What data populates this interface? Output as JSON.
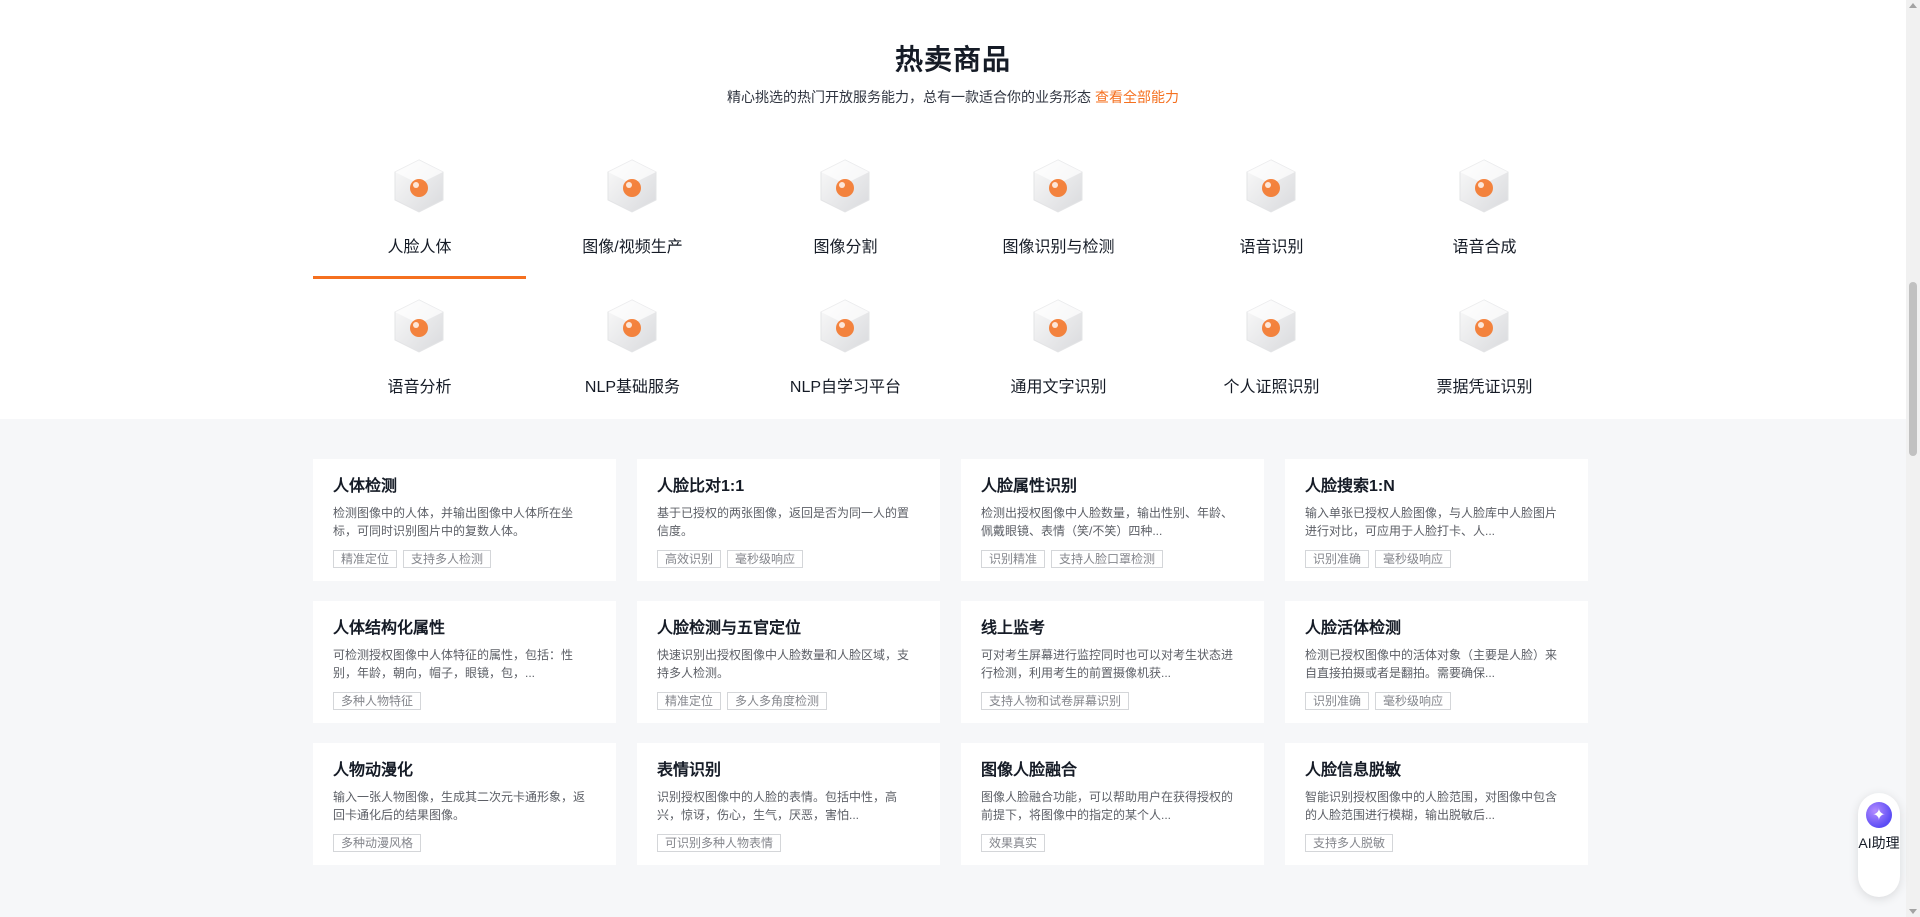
{
  "header": {
    "title": "热卖商品",
    "subtitle": "精心挑选的热门开放服务能力，总有一款适合你的业务形态",
    "link": "查看全部能力"
  },
  "categories": [
    {
      "label": "人脸人体",
      "icon": "face-body-icon",
      "active": true
    },
    {
      "label": "图像/视频生产",
      "icon": "image-video-icon"
    },
    {
      "label": "图像分割",
      "icon": "image-segment-icon"
    },
    {
      "label": "图像识别与检测",
      "icon": "image-recognition-icon"
    },
    {
      "label": "语音识别",
      "icon": "speech-recognition-icon"
    },
    {
      "label": "语音合成",
      "icon": "speech-synthesis-icon"
    },
    {
      "label": "语音分析",
      "icon": "speech-analysis-icon"
    },
    {
      "label": "NLP基础服务",
      "icon": "nlp-basic-icon"
    },
    {
      "label": "NLP自学习平台",
      "icon": "nlp-platform-icon"
    },
    {
      "label": "通用文字识别",
      "icon": "ocr-icon"
    },
    {
      "label": "个人证照识别",
      "icon": "id-card-icon"
    },
    {
      "label": "票据凭证识别",
      "icon": "receipt-icon"
    }
  ],
  "cards": [
    {
      "title": "人体检测",
      "desc": "检测图像中的人体，并输出图像中人体所在坐标，可同时识别图片中的复数人体。",
      "tags": [
        "精准定位",
        "支持多人检测"
      ]
    },
    {
      "title": "人脸比对1:1",
      "desc": "基于已授权的两张图像，返回是否为同一人的置信度。",
      "tags": [
        "高效识别",
        "毫秒级响应"
      ]
    },
    {
      "title": "人脸属性识别",
      "desc": "检测出授权图像中人脸数量，输出性别、年龄、佩戴眼镜、表情（笑/不笑）四种...",
      "tags": [
        "识别精准",
        "支持人脸口罩检测"
      ]
    },
    {
      "title": "人脸搜索1:N",
      "desc": "输入单张已授权人脸图像，与人脸库中人脸图片进行对比，可应用于人脸打卡、人...",
      "tags": [
        "识别准确",
        "毫秒级响应"
      ]
    },
    {
      "title": "人体结构化属性",
      "desc": "可检测授权图像中人体特征的属性，包括：性别，年龄，朝向，帽子，眼镜，包，...",
      "tags": [
        "多种人物特征"
      ]
    },
    {
      "title": "人脸检测与五官定位",
      "desc": "快速识别出授权图像中人脸数量和人脸区域，支持多人检测。",
      "tags": [
        "精准定位",
        "多人多角度检测"
      ]
    },
    {
      "title": "线上监考",
      "desc": "可对考生屏幕进行监控同时也可以对考生状态进行检测，利用考生的前置摄像机获...",
      "tags": [
        "支持人物和试卷屏幕识别"
      ]
    },
    {
      "title": "人脸活体检测",
      "desc": "检测已授权图像中的活体对象（主要是人脸）来自直接拍摄或者是翻拍。需要确保...",
      "tags": [
        "识别准确",
        "毫秒级响应"
      ]
    },
    {
      "title": "人物动漫化",
      "desc": "输入一张人物图像，生成其二次元卡通形象，返回卡通化后的结果图像。",
      "tags": [
        "多种动漫风格"
      ]
    },
    {
      "title": "表情识别",
      "desc": "识别授权图像中的人脸的表情。包括中性，高兴，惊讶，伤心，生气，厌恶，害怕...",
      "tags": [
        "可识别多种人物表情"
      ]
    },
    {
      "title": "图像人脸融合",
      "desc": "图像人脸融合功能，可以帮助用户在获得授权的前提下，将图像中的指定的某个人...",
      "tags": [
        "效果真实"
      ]
    },
    {
      "title": "人脸信息脱敏",
      "desc": "智能识别授权图像中的人脸范围，对图像中包含的人脸范围进行模糊，输出脱敏后...",
      "tags": [
        "支持多人脱敏"
      ]
    }
  ],
  "assistant": {
    "label": "AI助理",
    "icon": "ai-assistant-icon"
  },
  "colors": {
    "accent": "#f5701f",
    "background": "#f6f7f9",
    "text": "#151b26"
  }
}
